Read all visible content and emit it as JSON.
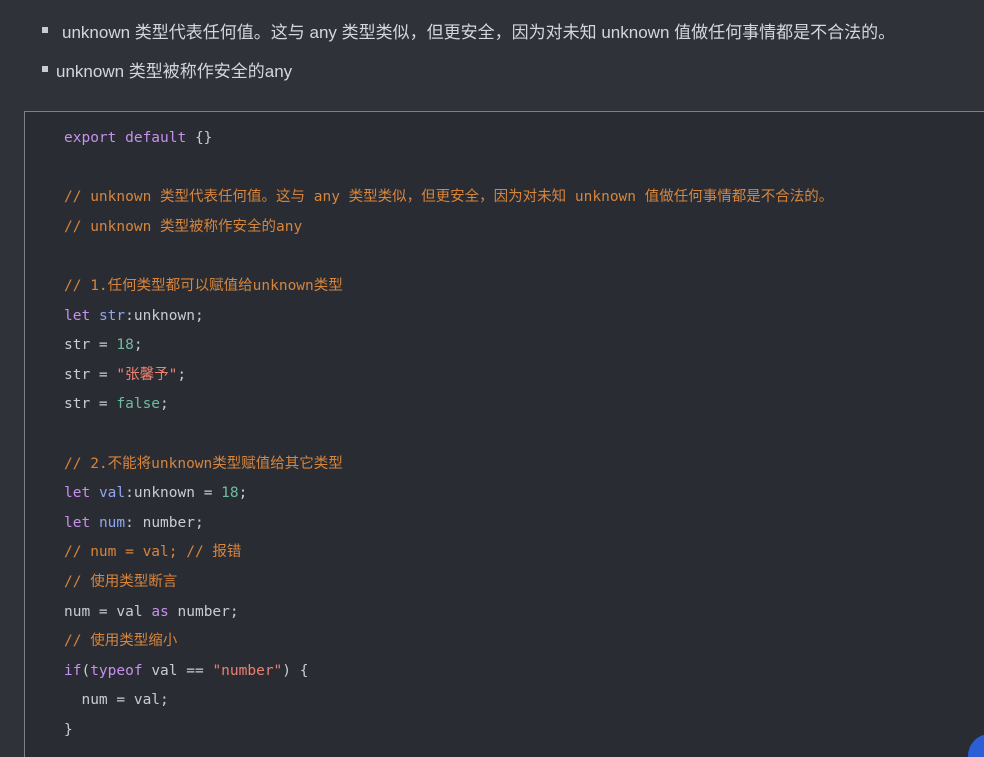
{
  "bullets": [
    "unknown 类型代表任何值。这与 any 类型类似，但更安全，因为对未知 unknown 值做任何事情都是不合法的。",
    "unknown 类型被称作安全的any"
  ],
  "code": [
    [
      [
        "kw",
        "export default"
      ],
      [
        "tx",
        " {}"
      ]
    ],
    [],
    [
      [
        "cm",
        "// unknown 类型代表任何值。这与 any 类型类似，但更安全，因为对未知 unknown 值做任何事情都是不合法的。"
      ]
    ],
    [
      [
        "cm",
        "// unknown 类型被称作安全的any"
      ]
    ],
    [],
    [
      [
        "cm",
        "// 1.任何类型都可以赋值给unknown类型"
      ]
    ],
    [
      [
        "kw",
        "let"
      ],
      [
        "tx",
        " "
      ],
      [
        "vr",
        "str"
      ],
      [
        "tx",
        ":unknown;"
      ]
    ],
    [
      [
        "tx",
        "str = "
      ],
      [
        "nm",
        "18"
      ],
      [
        "tx",
        ";"
      ]
    ],
    [
      [
        "tx",
        "str = "
      ],
      [
        "st",
        "\"张馨予\""
      ],
      [
        "tx",
        ";"
      ]
    ],
    [
      [
        "tx",
        "str = "
      ],
      [
        "nm",
        "false"
      ],
      [
        "tx",
        ";"
      ]
    ],
    [],
    [
      [
        "cm",
        "// 2.不能将unknown类型赋值给其它类型"
      ]
    ],
    [
      [
        "kw",
        "let"
      ],
      [
        "tx",
        " "
      ],
      [
        "vr",
        "val"
      ],
      [
        "tx",
        ":unknown = "
      ],
      [
        "nm",
        "18"
      ],
      [
        "tx",
        ";"
      ]
    ],
    [
      [
        "kw",
        "let"
      ],
      [
        "tx",
        " "
      ],
      [
        "vr",
        "num"
      ],
      [
        "tx",
        ": number;"
      ]
    ],
    [
      [
        "cm",
        "// num = val; // 报错"
      ]
    ],
    [
      [
        "cm",
        "// 使用类型断言"
      ]
    ],
    [
      [
        "tx",
        "num = val "
      ],
      [
        "kw",
        "as"
      ],
      [
        "tx",
        " number;"
      ]
    ],
    [
      [
        "cm",
        "// 使用类型缩小"
      ]
    ],
    [
      [
        "kw",
        "if"
      ],
      [
        "tx",
        "("
      ],
      [
        "kw",
        "typeof"
      ],
      [
        "tx",
        " val == "
      ],
      [
        "st",
        "\"number\""
      ],
      [
        "tx",
        ") {"
      ]
    ],
    [
      [
        "tx",
        "  num = val;"
      ]
    ],
    [
      [
        "tx",
        "}"
      ]
    ]
  ]
}
